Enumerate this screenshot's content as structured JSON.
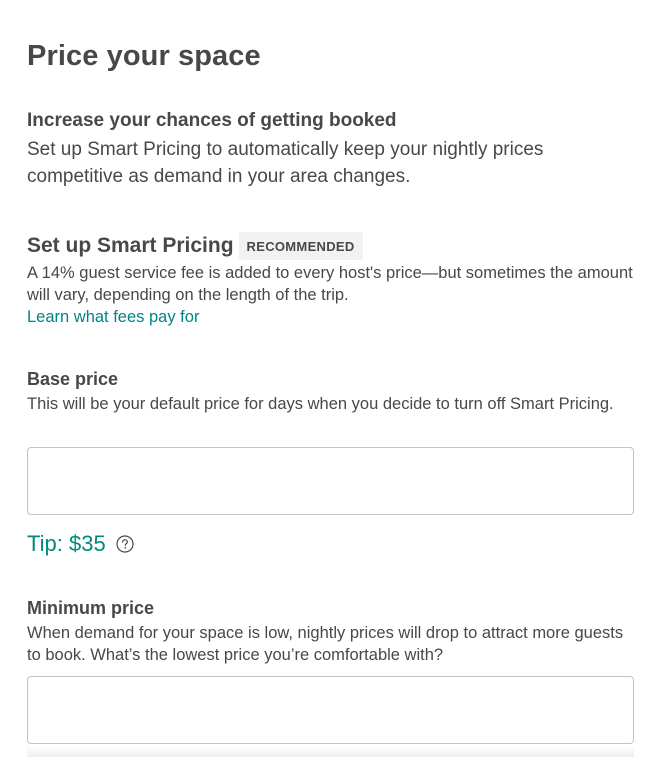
{
  "page": {
    "title": "Price your space"
  },
  "intro": {
    "heading": "Increase your chances of getting booked",
    "description": "Set up Smart Pricing to automatically keep your nightly prices competitive as demand in your area changes."
  },
  "smart_pricing": {
    "title": "Set up Smart Pricing",
    "badge": "RECOMMENDED",
    "fee_text": "A 14% guest service fee is added to every host's price—but sometimes the amount will vary, depending on the length of the trip.",
    "link_label": "Learn what fees pay for"
  },
  "base_price": {
    "label": "Base price",
    "description": "This will be your default price for days when you decide to turn off Smart Pricing.",
    "value": "",
    "tip": "Tip: $35",
    "help_icon": "question-circle-icon"
  },
  "minimum_price": {
    "label": "Minimum price",
    "description": "When demand for your space is low, nightly prices will drop to attract more guests to book. What’s the lowest price you’re comfortable with?",
    "value": ""
  },
  "colors": {
    "text": "#484848",
    "link": "#008489",
    "tip": "#008a7d",
    "badge_bg": "#f2f2f2",
    "input_border": "#c4c4c4"
  }
}
